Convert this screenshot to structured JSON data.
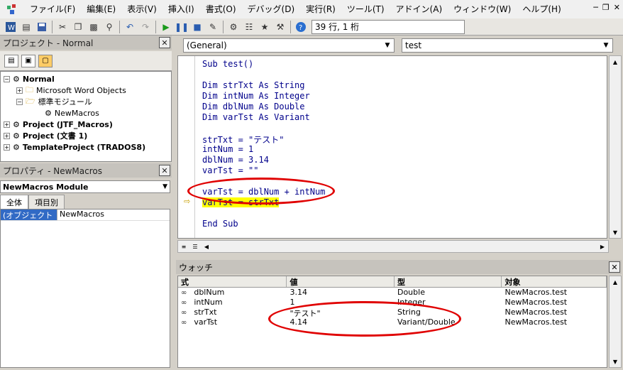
{
  "menubar": {
    "items": [
      "ファイル(F)",
      "編集(E)",
      "表示(V)",
      "挿入(I)",
      "書式(O)",
      "デバッグ(D)",
      "実行(R)",
      "ツール(T)",
      "アドイン(A)",
      "ウィンドウ(W)",
      "ヘルプ(H)"
    ]
  },
  "toolbar": {
    "position_text": "39 行, 1 桁"
  },
  "project_pane": {
    "title": "プロジェクト - Normal",
    "tree": [
      {
        "label": "Normal",
        "bold": true
      },
      {
        "label": "Microsoft Word Objects",
        "bold": false
      },
      {
        "label": "標準モジュール",
        "bold": false
      },
      {
        "label": "NewMacros",
        "bold": false
      },
      {
        "label": "Project (JTF_Macros)",
        "bold": true
      },
      {
        "label": "Project (文書 1)",
        "bold": true
      },
      {
        "label": "TemplateProject (TRADOS8)",
        "bold": true
      }
    ]
  },
  "properties_pane": {
    "title": "プロパティ - NewMacros",
    "object_select": "NewMacros Module",
    "tabs": [
      "全体",
      "項目別"
    ],
    "rows": [
      {
        "name": "(オブジェクト名)",
        "value": "NewMacros"
      }
    ]
  },
  "editor": {
    "object_combo": "(General)",
    "proc_combo": "test",
    "lines": [
      "Sub test()",
      "",
      "Dim strTxt As String",
      "Dim intNum As Integer",
      "Dim dblNum As Double",
      "Dim varTst As Variant",
      "",
      "strTxt = \"テスト\"",
      "intNum = 1",
      "dblNum = 3.14",
      "varTst = \"\"",
      "",
      "varTst = dblNum + intNum",
      "varTst = strTxt",
      "",
      "End Sub"
    ]
  },
  "watch": {
    "title": "ウォッチ",
    "headers": [
      "式",
      "値",
      "型",
      "対象"
    ],
    "rows": [
      {
        "expr": "dblNum",
        "value": "3.14",
        "type": "Double",
        "context": "NewMacros.test"
      },
      {
        "expr": "intNum",
        "value": "1",
        "type": "Integer",
        "context": "NewMacros.test"
      },
      {
        "expr": "strTxt",
        "value": "\"テスト\"",
        "type": "String",
        "context": "NewMacros.test"
      },
      {
        "expr": "varTst",
        "value": "4.14",
        "type": "Variant/Double",
        "context": "NewMacros.test"
      }
    ]
  },
  "colors": {
    "highlight": "#ffff00",
    "annotation": "#e00000",
    "selection": "#316ac5"
  }
}
